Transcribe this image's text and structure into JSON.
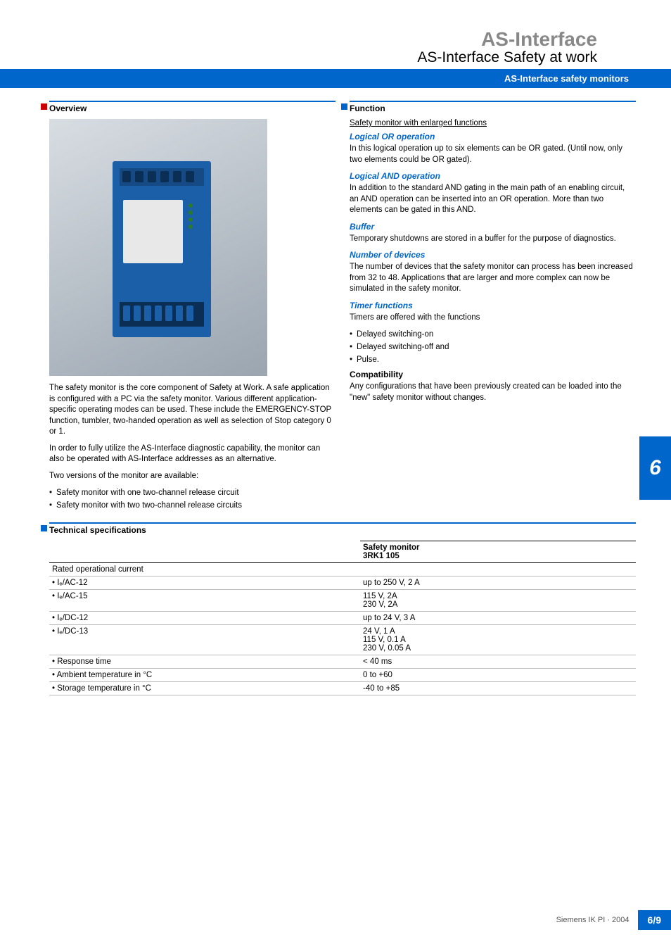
{
  "header": {
    "title": "AS-Interface",
    "subtitle": "AS-Interface Safety at work",
    "bar": "AS-Interface safety monitors"
  },
  "overview": {
    "heading": "Overview",
    "p1": "The safety monitor is the core component of Safety at Work. A safe application is configured with a PC via the safety monitor. Various different application-specific operating modes can be used. These include the EMERGENCY-STOP function, tumbler, two-handed operation as well as selection of Stop category 0 or 1.",
    "p2": "In order to fully utilize the AS-Interface diagnostic capability, the monitor can also be operated with AS-Interface addresses as an alternative.",
    "p3": "Two versions of the monitor are available:",
    "bullets": [
      "Safety monitor with one two-channel release circuit",
      "Safety monitor with two two-channel release circuits"
    ]
  },
  "function": {
    "heading": "Function",
    "intro": "Safety monitor with enlarged functions",
    "sections": [
      {
        "title": "Logical OR operation",
        "body": "In this logical operation up to six elements can be OR gated. (Until now, only two elements could be OR gated)."
      },
      {
        "title": "Logical AND operation",
        "body": "In addition to the standard AND gating in the main path of an enabling circuit, an AND operation can be inserted into an OR operation. More than two elements can be gated in this AND."
      },
      {
        "title": "Buffer",
        "body": "Temporary shutdowns are stored in a buffer for the purpose of diagnostics."
      },
      {
        "title": "Number of devices",
        "body": "The number of devices that the safety monitor can process has been increased from 32 to 48. Applications that are larger and more complex can now be simulated in the safety monitor."
      },
      {
        "title": "Timer functions",
        "body": "Timers are offered with the functions",
        "bullets": [
          "Delayed switching-on",
          "Delayed switching-off and",
          "Pulse."
        ]
      }
    ],
    "compat_heading": "Compatibility",
    "compat_body": "Any configurations that have been previously created can be loaded into the \"new\" safety monitor without changes."
  },
  "tech": {
    "heading": "Technical specifications",
    "col_header": "Safety monitor\n3RK1 105",
    "rows": [
      {
        "param": "Rated operational current",
        "value": ""
      },
      {
        "param": "• Iₑ/AC-12",
        "value": "up to 250 V, 2 A"
      },
      {
        "param": "• Iₑ/AC-15",
        "value": "115 V, 2A\n230 V, 2A"
      },
      {
        "param": "• Iₑ/DC-12",
        "value": "up to 24 V, 3 A"
      },
      {
        "param": "• Iₑ/DC-13",
        "value": "24 V, 1 A\n115 V, 0.1 A\n230 V, 0.05 A"
      },
      {
        "param": "• Response time",
        "value": "< 40 ms"
      },
      {
        "param": "• Ambient temperature in °C",
        "value": "0 to +60"
      },
      {
        "param": "• Storage temperature in °C",
        "value": "-40 to +85"
      }
    ]
  },
  "side_tab": "6",
  "footer": {
    "text": "Siemens IK PI · 2004",
    "page": "6/9"
  }
}
